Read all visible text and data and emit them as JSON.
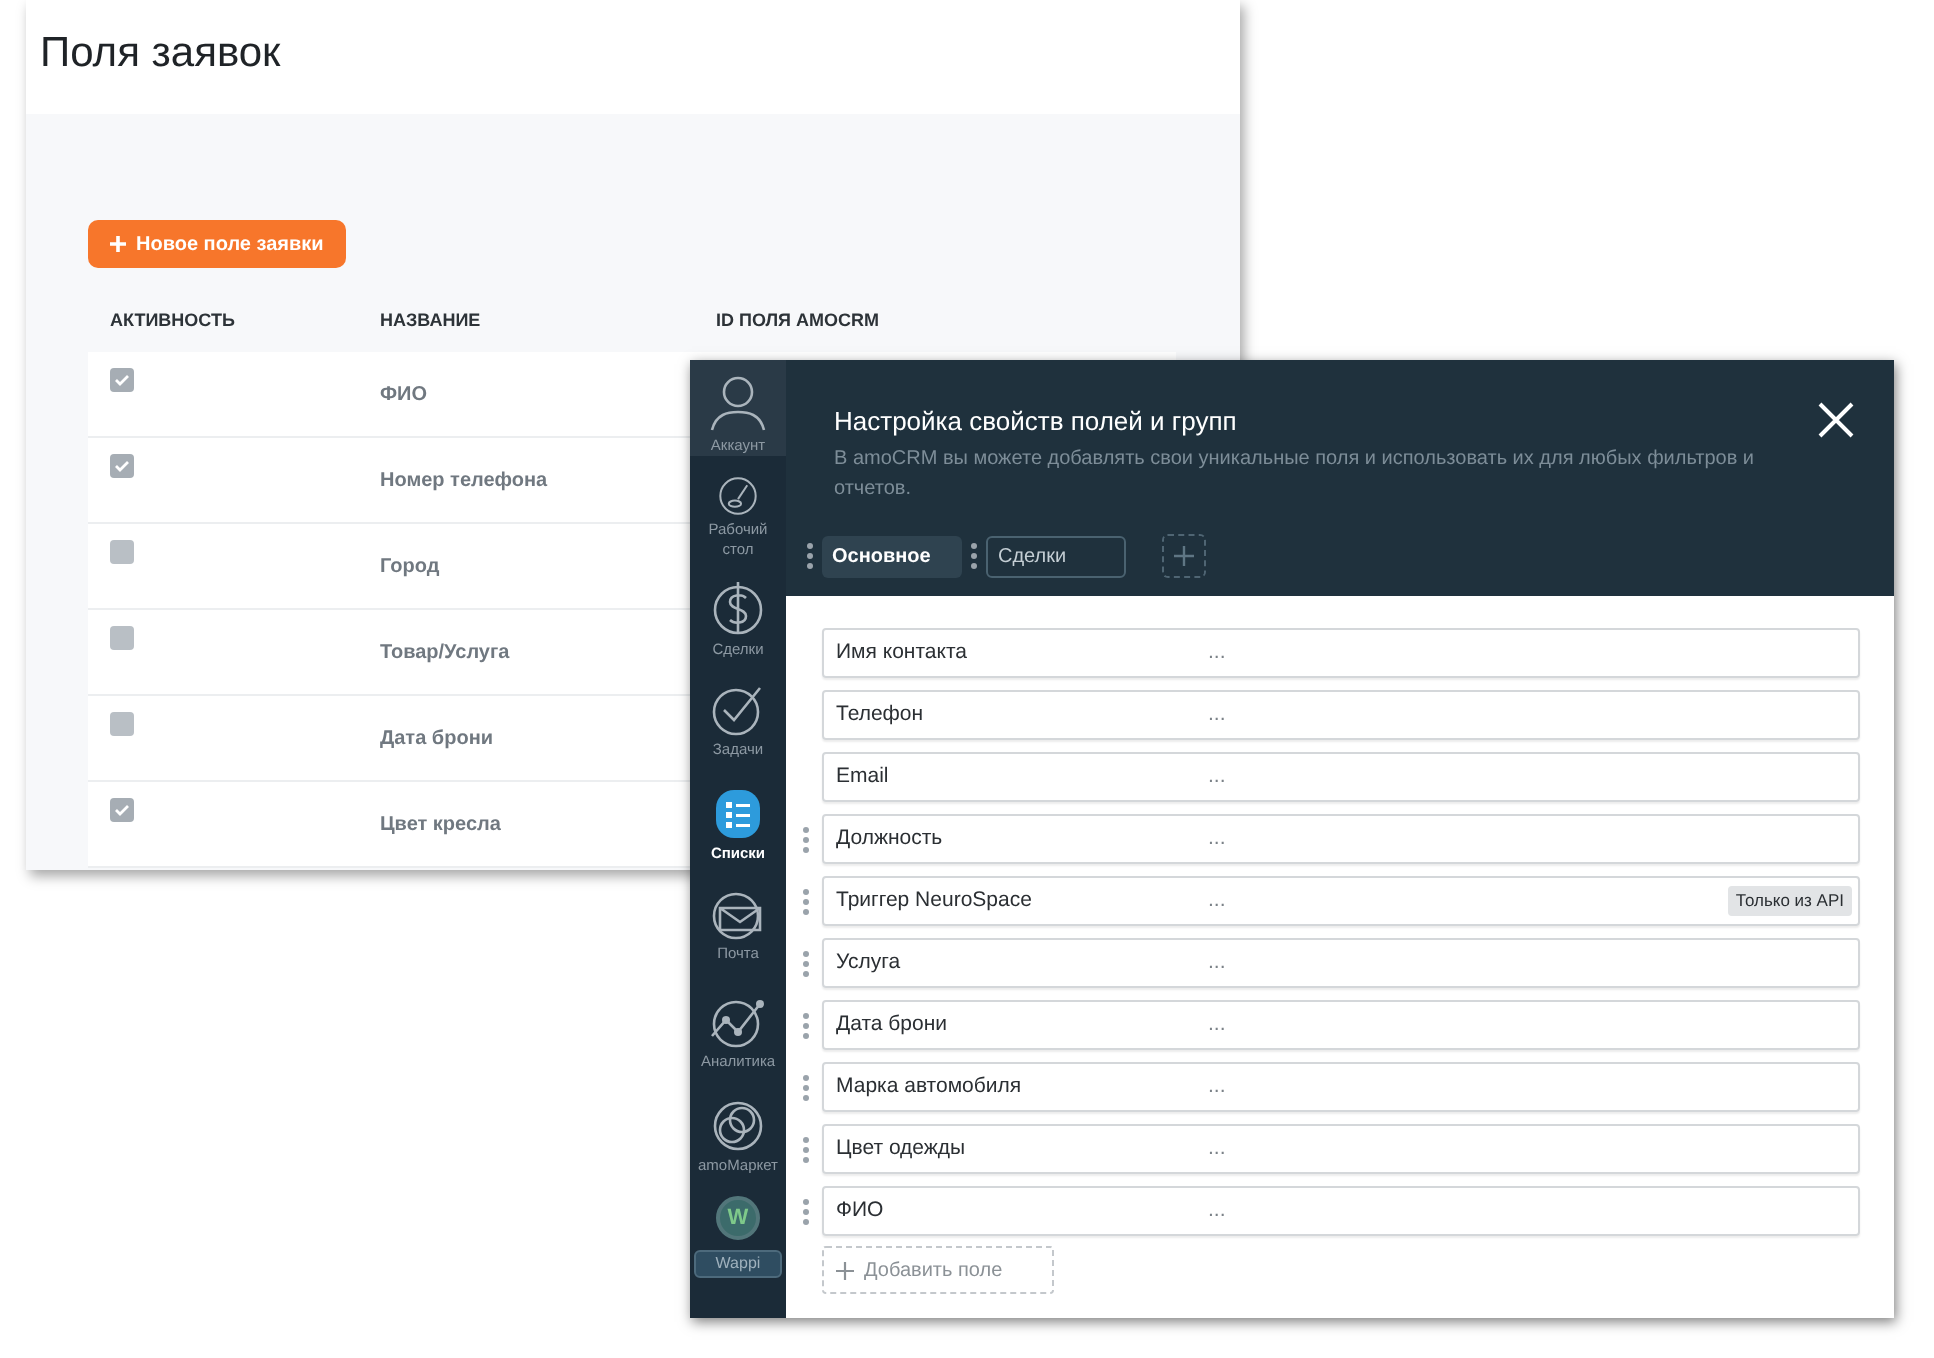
{
  "requests_page": {
    "title": "Поля заявок",
    "new_field_button": "Новое поле заявки",
    "table": {
      "columns": [
        "АКТИВНОСТЬ",
        "НАЗВАНИЕ",
        "ID ПОЛЯ AMOCRM"
      ],
      "rows": [
        {
          "active": true,
          "name": "ФИО"
        },
        {
          "active": true,
          "name": "Номер телефона"
        },
        {
          "active": false,
          "name": "Город"
        },
        {
          "active": false,
          "name": "Товар/Услуга"
        },
        {
          "active": false,
          "name": "Дата брони"
        },
        {
          "active": true,
          "name": "Цвет кресла"
        }
      ]
    }
  },
  "crm_window": {
    "sidebar": {
      "items": [
        {
          "kind": "account",
          "label": "Аккаунт",
          "selected": false
        },
        {
          "kind": "dashboard",
          "label": "Рабочий стол",
          "selected": false
        },
        {
          "kind": "deals",
          "label": "Сделки",
          "selected": false
        },
        {
          "kind": "tasks",
          "label": "Задачи",
          "selected": false
        },
        {
          "kind": "lists",
          "label": "Списки",
          "selected": true
        },
        {
          "kind": "mail",
          "label": "Почта",
          "selected": false
        },
        {
          "kind": "analytics",
          "label": "Аналитика",
          "selected": false
        },
        {
          "kind": "market",
          "label": "amoМаркет",
          "selected": false
        },
        {
          "kind": "widget",
          "label": "Wappi",
          "icon_letter": "W",
          "selected": false
        }
      ]
    },
    "title": "Настройка свойств полей и групп",
    "description": "В amoCRM вы можете добавлять свои уникальные поля и использовать их для любых фильтров и отчетов.",
    "tabs": [
      {
        "label": "Основное",
        "selected": true
      },
      {
        "label": "Сделки",
        "selected": false
      }
    ],
    "fields": [
      {
        "name": "Имя контакта",
        "value": "...",
        "draggable": false
      },
      {
        "name": "Телефон",
        "value": "...",
        "draggable": false
      },
      {
        "name": "Email",
        "value": "...",
        "draggable": false
      },
      {
        "name": "Должность",
        "value": "...",
        "draggable": true
      },
      {
        "name": "Триггер NeuroSpace",
        "value": "...",
        "draggable": true,
        "badge": "Только из API"
      },
      {
        "name": "Услуга",
        "value": "...",
        "draggable": true
      },
      {
        "name": "Дата брони",
        "value": "...",
        "draggable": true
      },
      {
        "name": "Марка автомобиля",
        "value": "...",
        "draggable": true
      },
      {
        "name": "Цвет одежды",
        "value": "...",
        "draggable": true
      },
      {
        "name": "ФИО",
        "value": "...",
        "draggable": true
      }
    ],
    "add_field_button": "Добавить поле"
  }
}
